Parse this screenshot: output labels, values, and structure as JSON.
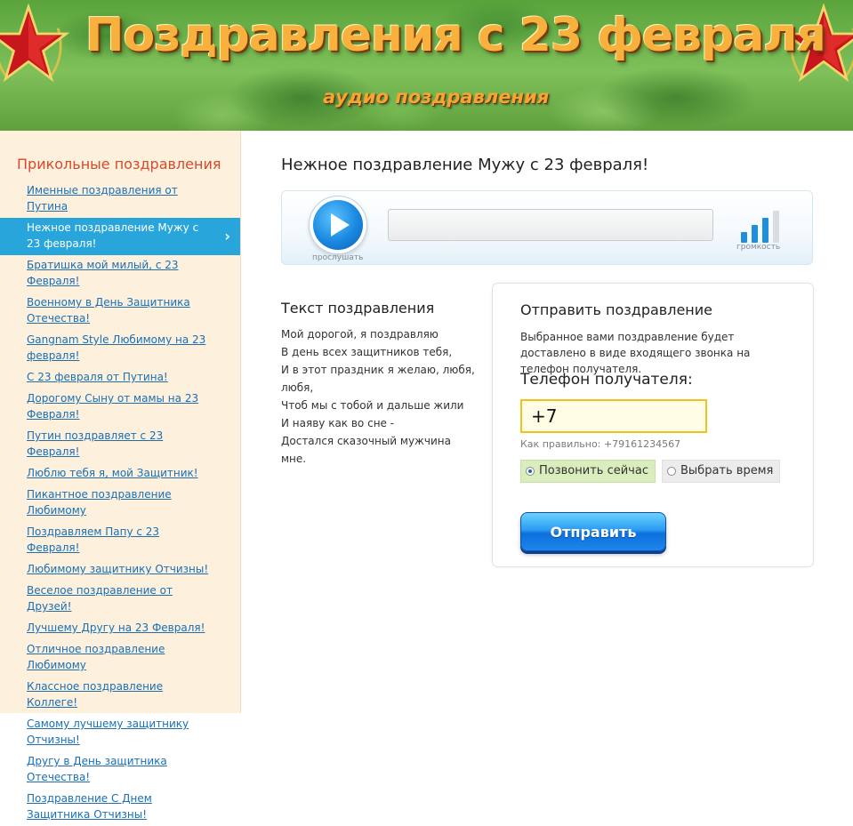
{
  "header": {
    "title": "Поздравления с 23 февраля",
    "subtitle": "аудио поздравления"
  },
  "sidebar": {
    "heading": "Прикольные поздравления",
    "items": [
      {
        "label": "Именные поздравления от Путина"
      },
      {
        "label": "Нежное поздравление Мужу с 23 февраля!",
        "active": true
      },
      {
        "label": "Братишка мой милый, с 23 Февраля!"
      },
      {
        "label": "Военному в День Защитника Отечества!"
      },
      {
        "label": "Gangnam Style Любимому на 23 февраля!"
      },
      {
        "label": "С 23 февраля от Путина!"
      },
      {
        "label": "Дорогому Сыну от мамы на 23 Февраля!"
      },
      {
        "label": "Путин поздравляет с 23 Февраля!"
      },
      {
        "label": "Люблю тебя я, мой Защитник!"
      },
      {
        "label": "Пикантное поздравление Любимому"
      },
      {
        "label": "Поздравляем Папу с 23 Февраля!"
      },
      {
        "label": "Любимому защитнику Отчизны!"
      },
      {
        "label": "Веселое поздравление от Друзей!"
      },
      {
        "label": "Лучшему Другу на 23 Февраля!"
      },
      {
        "label": "Отличное поздравление Любимому"
      },
      {
        "label": "Классное поздравление Коллеге!"
      },
      {
        "label": "Самому лучшему защитнику Отчизны!"
      },
      {
        "label": "Другу в День защитника Отечества!"
      },
      {
        "label": "Поздравление С Днем Защитника Отчизны!"
      }
    ]
  },
  "main": {
    "title": "Нежное поздравление Мужу с 23 февраля!",
    "player": {
      "play_label": "прослушать",
      "volume_label": "громкость",
      "volume_level": 3,
      "volume_max": 4
    },
    "lyrics": {
      "heading": "Текст поздравления",
      "lines": [
        "Мой дорогой, я поздравляю",
        "В день всех защитников тебя,",
        "И в этот праздник я желаю, любя,",
        "любя,",
        "Чтоб мы с тобой и дальше жили",
        "И наяву как во сне -",
        "Достался сказочный мужчина мне."
      ]
    },
    "send": {
      "heading": "Отправить поздравление",
      "description": "Выбранное вами поздравление будет доставлено в виде входящего звонка на телефон получателя.",
      "phone_label": "Телефон получателя:",
      "phone_value": "+7",
      "phone_hint": "Как правильно: +79161234567",
      "option_now": "Позвонить сейчас",
      "option_time": "Выбрать время",
      "selected_option": "now",
      "button_label": "Отправить"
    }
  },
  "colors": {
    "sidebar_bg": "#fdf1de",
    "active_item": "#28a6db",
    "link": "#1a6fb5",
    "sidebar_heading": "#d7492a",
    "title_orange": "#f7b13c",
    "input_border": "#f1c21a",
    "button_blue": "#1a88e0"
  }
}
